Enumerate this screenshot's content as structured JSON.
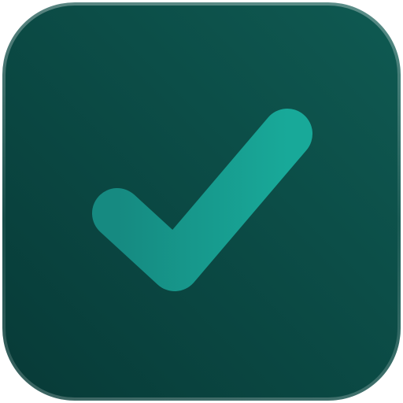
{
  "app_icon": {
    "icon_name": "checkmark-icon",
    "colors": {
      "background_top_right": "#0F5A52",
      "background_bottom_left": "#073A37",
      "border_highlight": "#7FB2AA",
      "check_start": "#168A81",
      "check_end": "#18A999"
    }
  }
}
